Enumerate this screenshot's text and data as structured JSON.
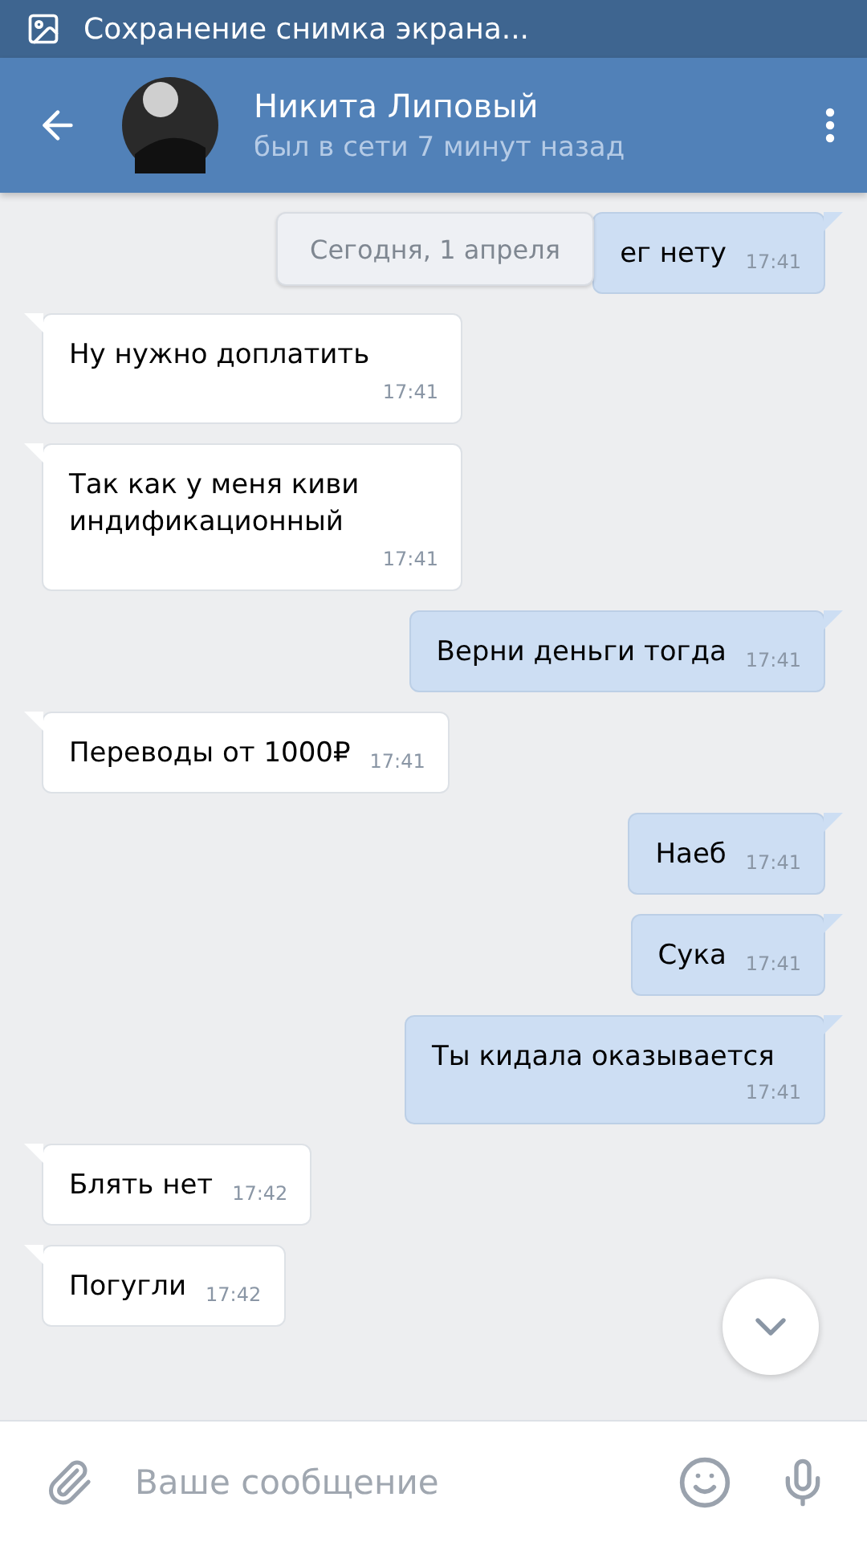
{
  "status_bar": {
    "notification": "Сохранение снимка экрана..."
  },
  "header": {
    "name": "Никита Липовый",
    "status": "был в сети 7 минут назад"
  },
  "date_label": "Сегодня, 1 апреля",
  "messages": [
    {
      "text": "ег нету",
      "time": "17:41",
      "outgoing": true
    },
    {
      "text": "Ну нужно доплатить",
      "time": "17:41",
      "outgoing": false
    },
    {
      "text": "Так как у меня киви индификационный",
      "time": "17:41",
      "outgoing": false
    },
    {
      "text": "Верни деньги тогда",
      "time": "17:41",
      "outgoing": true
    },
    {
      "text": "Переводы от 1000₽",
      "time": "17:41",
      "outgoing": false
    },
    {
      "text": "Наеб",
      "time": "17:41",
      "outgoing": true
    },
    {
      "text": "Сука",
      "time": "17:41",
      "outgoing": true
    },
    {
      "text": "Ты кидала оказывается",
      "time": "17:41",
      "outgoing": true
    },
    {
      "text": "Блять нет",
      "time": "17:42",
      "outgoing": false
    },
    {
      "text": "Погугли",
      "time": "17:42",
      "outgoing": false
    }
  ],
  "composer": {
    "placeholder": "Ваше сообщение"
  }
}
